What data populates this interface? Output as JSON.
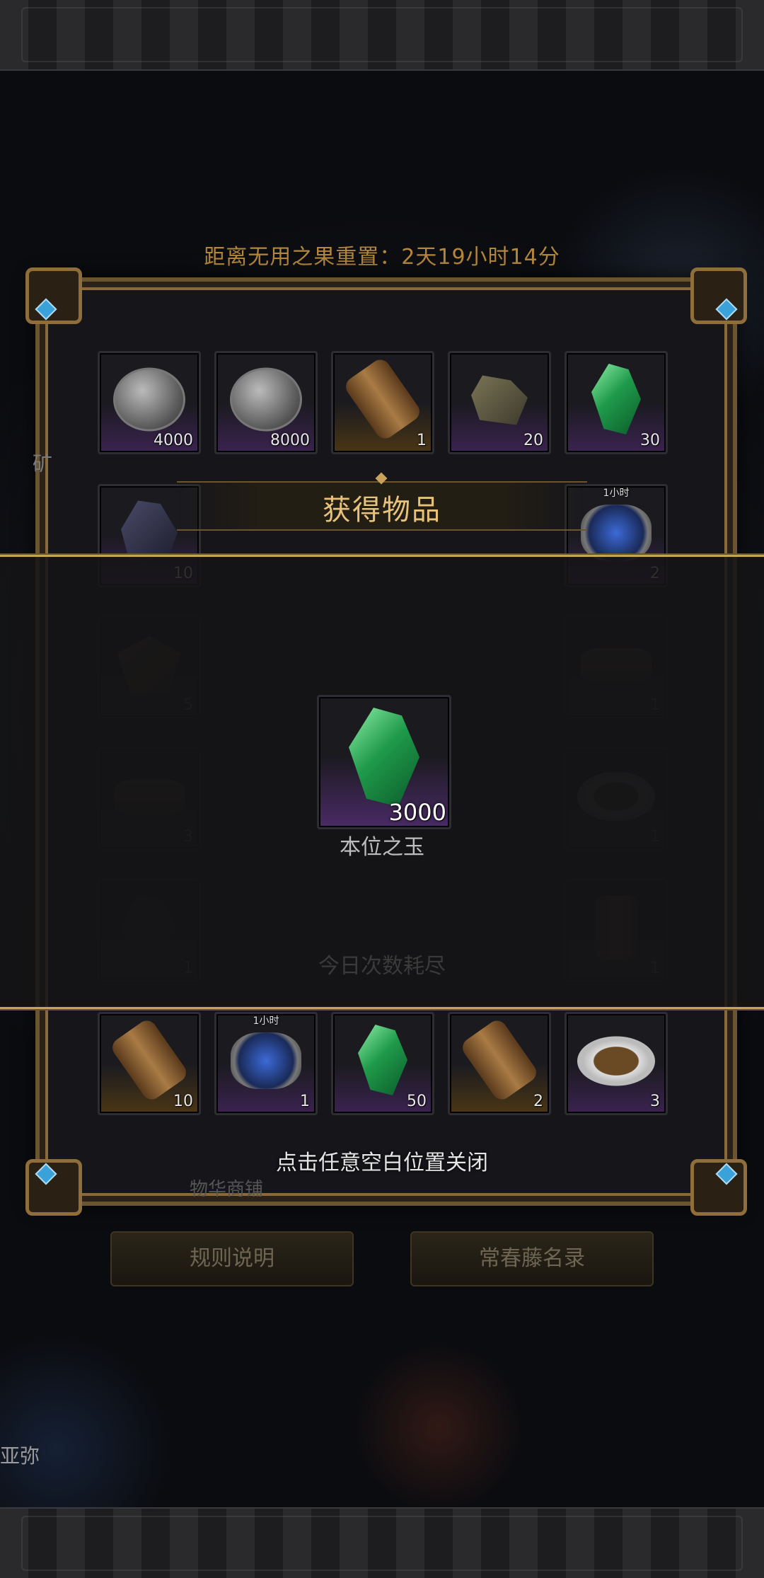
{
  "reset_timer": "距离无用之果重置：2天19小时14分",
  "grid_top_row": [
    {
      "icon": "silver-coin-icon",
      "count": "4000",
      "rarity": "purple"
    },
    {
      "icon": "silver-coin-icon",
      "count": "8000",
      "rarity": "purple"
    },
    {
      "icon": "scroll-icon",
      "count": "1",
      "rarity": "gold"
    },
    {
      "icon": "ore-icon",
      "count": "20",
      "rarity": "purple"
    },
    {
      "icon": "green-gem-icon",
      "count": "30",
      "rarity": "purple"
    }
  ],
  "grid_row2": {
    "left": {
      "icon": "dark-ore-icon",
      "count": "10"
    },
    "right": {
      "icon": "orb-icon",
      "count": "2",
      "tag": "1小时"
    }
  },
  "grid_hidden_rows": [
    {
      "left": {
        "icon": "leaf-icon",
        "count": "5"
      },
      "right": {
        "icon": "bread-icon",
        "count": "1"
      }
    },
    {
      "left": {
        "icon": "bread-icon",
        "count": "3"
      },
      "right": {
        "icon": "plate-icon",
        "count": "1"
      }
    },
    {
      "left": {
        "icon": "figure-icon",
        "count": "1"
      },
      "right": {
        "icon": "jar-icon",
        "count": "1"
      }
    }
  ],
  "grid_bottom_row": [
    {
      "icon": "scroll-icon",
      "count": "10",
      "rarity": "gold"
    },
    {
      "icon": "orb-icon",
      "count": "1",
      "tag": "1小时",
      "rarity": "purple"
    },
    {
      "icon": "green-gem-icon",
      "count": "50",
      "rarity": "purple"
    },
    {
      "icon": "scroll-icon",
      "count": "2",
      "rarity": "gold"
    },
    {
      "icon": "plate-icon",
      "count": "3",
      "rarity": "purple"
    }
  ],
  "faded_center_text": "今日次数耗尽",
  "popup": {
    "title": "获得物品",
    "reward": {
      "icon": "green-gem-icon",
      "count": "3000",
      "name": "本位之玉"
    },
    "close_hint": "点击任意空白位置关闭"
  },
  "buttons": {
    "rules": "规则说明",
    "ivy_list": "常春藤名录"
  },
  "side_texts": {
    "left_partial": "矿",
    "bottom_left": "亚弥",
    "behind_hint": "物华商铺"
  },
  "colors": {
    "accent_gold": "#c9a25a",
    "timer_text": "#b4873c",
    "title_text": "#e8c27a"
  }
}
